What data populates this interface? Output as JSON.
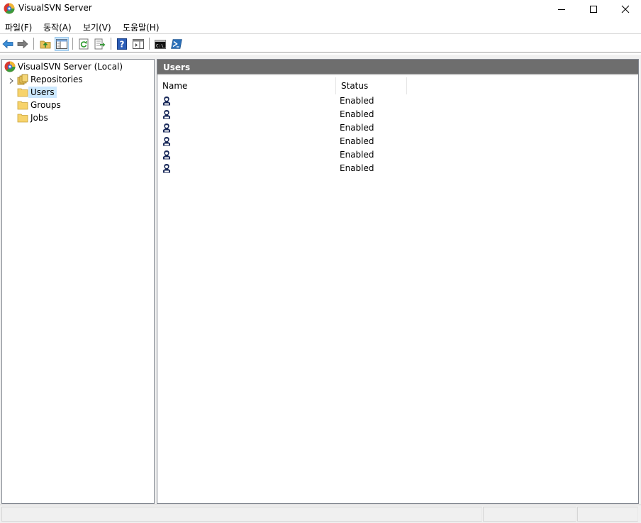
{
  "window": {
    "title": "VisualSVN Server",
    "controls": [
      "minimize-icon",
      "maximize-icon",
      "close-icon"
    ]
  },
  "menu": [
    {
      "label": "파일(F)"
    },
    {
      "label": "동작(A)"
    },
    {
      "label": "보기(V)"
    },
    {
      "label": "도움말(H)"
    }
  ],
  "toolbar": {
    "buttons": [
      "back-arrow-icon",
      "forward-arrow-icon",
      "up-folder-icon",
      "show-hide-tree-icon",
      "refresh-icon",
      "export-list-icon",
      "help-icon",
      "show-hide-action-pane-icon",
      "command-prompt-icon",
      "powershell-icon"
    ]
  },
  "tree": {
    "root": "VisualSVN Server (Local)",
    "items": [
      {
        "label": "Repositories",
        "icon": "repositories-icon"
      },
      {
        "label": "Users",
        "icon": "folder-icon",
        "selected": true
      },
      {
        "label": "Groups",
        "icon": "folder-icon"
      },
      {
        "label": "Jobs",
        "icon": "folder-icon"
      }
    ]
  },
  "main": {
    "header": "Users",
    "columns": [
      "Name",
      "Status"
    ],
    "rows": [
      {
        "name": "",
        "status": "Enabled"
      },
      {
        "name": "",
        "status": "Enabled"
      },
      {
        "name": "",
        "status": "Enabled"
      },
      {
        "name": "",
        "status": "Enabled"
      },
      {
        "name": "",
        "status": "Enabled"
      },
      {
        "name": "",
        "status": "Enabled"
      }
    ]
  },
  "colors": {
    "header_bg": "#6e6e6e",
    "selection_bg": "#cce8ff",
    "pressed_button_bg": "#cce4f7"
  }
}
